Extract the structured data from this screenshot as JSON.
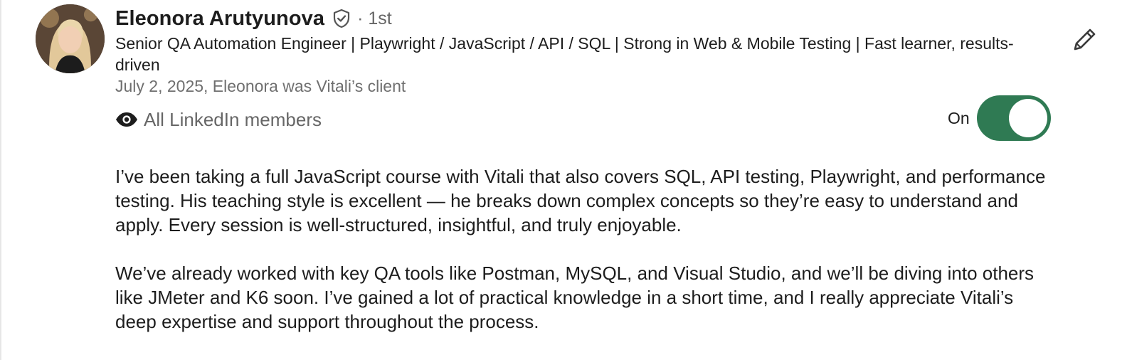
{
  "recommender": {
    "name": "Eleonora Arutyunova",
    "connection_degree": "· 1st",
    "headline": "Senior QA Automation Engineer | Playwright / JavaScript / API / SQL | Strong in Web & Mobile Testing | Fast learner, results-driven",
    "meta": "July 2, 2025, Eleonora was Vitali’s client"
  },
  "visibility": {
    "icon": "eye-icon",
    "label": "All LinkedIn members",
    "toggle_label": "On",
    "toggle_on": true
  },
  "recommendation": {
    "paragraphs": [
      "I’ve been taking a full JavaScript course with Vitali that also covers SQL, API testing, Playwright, and performance testing. His teaching style is excellent — he breaks down complex concepts so they’re easy to understand and apply. Every session is well-structured, insightful, and truly enjoyable.",
      "We’ve already worked with key QA tools like Postman, MySQL, and Visual Studio, and we’ll be diving into others like JMeter and K6 soon. I’ve gained a lot of practical knowledge in a short time, and I really appreciate Vitali’s deep expertise and support throughout the process."
    ]
  },
  "colors": {
    "toggle_on": "#2f7a53",
    "text_primary": "#1d1d1d",
    "text_secondary": "#666666"
  }
}
